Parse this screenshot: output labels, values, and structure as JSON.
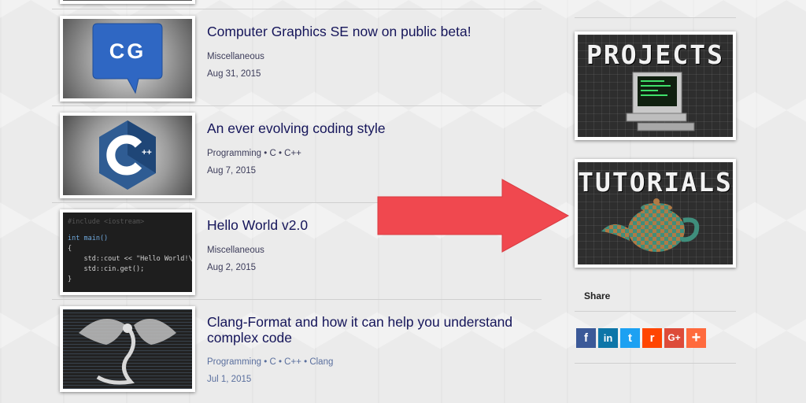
{
  "posts": [
    {
      "title": "Computer Graphics SE now on public beta!",
      "categories": "Miscellaneous",
      "date": "Aug 31, 2015",
      "thumbnail_text": "CG"
    },
    {
      "title": "An ever evolving coding style",
      "categories": "Programming • C • C++",
      "date": "Aug 7, 2015",
      "thumbnail_text": "C++"
    },
    {
      "title": "Hello World v2.0",
      "categories": "Miscellaneous",
      "date": "Aug 2, 2015",
      "thumbnail_code": {
        "line1": "#include <iostream>",
        "line2": "int main()",
        "line3": "{",
        "line4": "    std::cout << \"Hello World!\\n\";",
        "line5": "    std::cin.get();",
        "line6": "}"
      }
    },
    {
      "title": "Clang-Format and how it can help you understand complex code",
      "categories": "Programming • C • C++ • Clang",
      "date": "Jul 1, 2015"
    }
  ],
  "sidebar": {
    "projects_title": "PROJECTS",
    "tutorials_title": "TUTORIALS",
    "share_label": "Share",
    "share_buttons": [
      {
        "icon": "facebook-icon",
        "label": "f",
        "color": "#3b5998"
      },
      {
        "icon": "linkedin-icon",
        "label": "in",
        "color": "#0e76a8"
      },
      {
        "icon": "twitter-icon",
        "label": "t",
        "color": "#1da1f2"
      },
      {
        "icon": "reddit-icon",
        "label": "r",
        "color": "#ff4500"
      },
      {
        "icon": "google-plus-icon",
        "label": "G+",
        "color": "#dd4b39"
      },
      {
        "icon": "more-plus-icon",
        "label": "+",
        "color": "#ff6a3d"
      }
    ]
  },
  "colors": {
    "arrow": "#f0484f",
    "title": "#15155a",
    "link": "#5a6f9e"
  }
}
